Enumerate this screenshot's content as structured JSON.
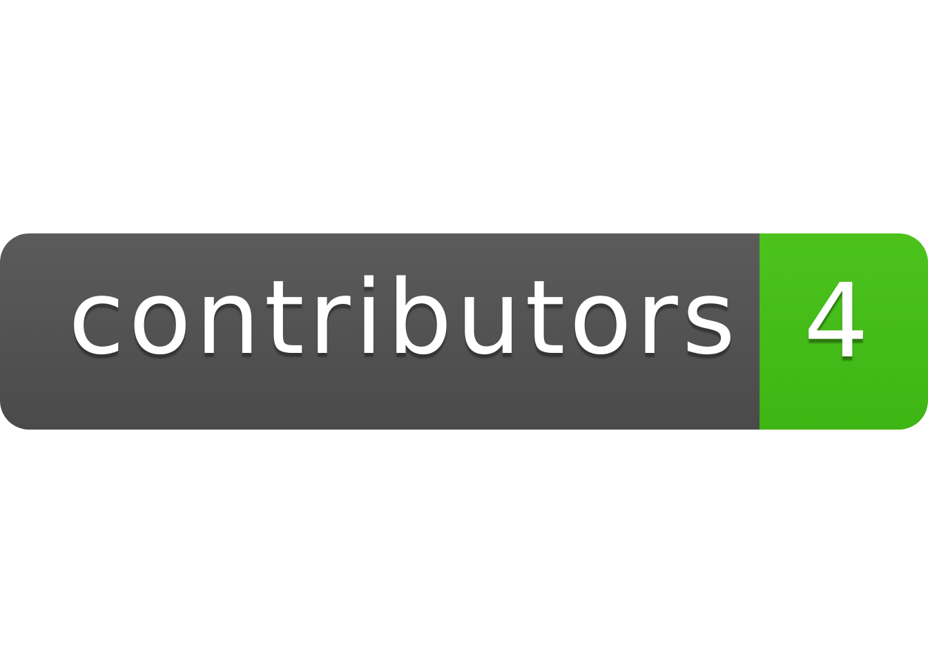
{
  "badge": {
    "label": "contributors",
    "value": "4",
    "colors": {
      "label_background": "#545454",
      "value_background": "#44bc18",
      "text": "#ffffff"
    }
  }
}
